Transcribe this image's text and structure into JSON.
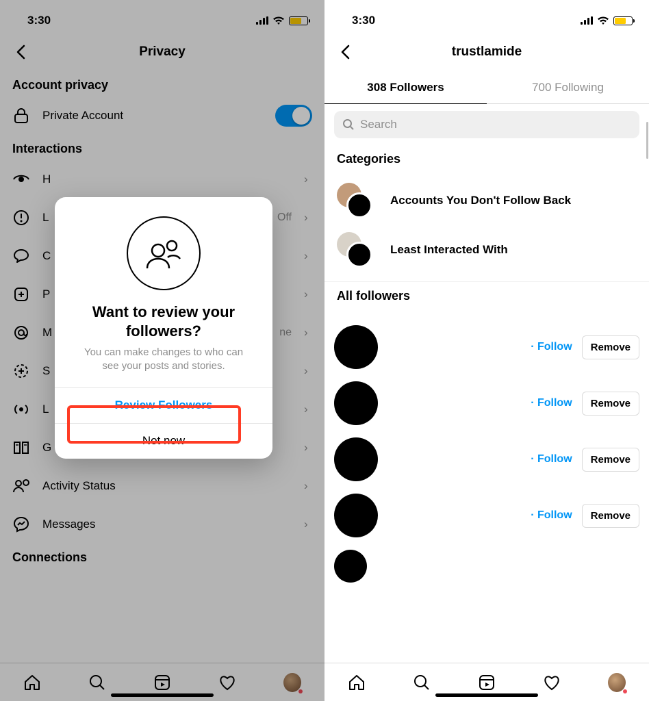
{
  "status": {
    "time": "3:30"
  },
  "left": {
    "title": "Privacy",
    "sections": {
      "account_privacy": "Account privacy",
      "interactions": "Interactions",
      "connections": "Connections"
    },
    "rows": {
      "private_account": "Private Account",
      "hidden_words": "H",
      "limits": "L",
      "limits_value": "Off",
      "comments": "C",
      "posts": "P",
      "mentions": "M",
      "mentions_value": "ne",
      "story": "S",
      "live": "L",
      "guides": "G",
      "activity_status": "Activity Status",
      "messages": "Messages"
    },
    "modal": {
      "title": "Want to review your followers?",
      "subtitle": "You can make changes to who can see your posts and stories.",
      "primary": "Review Followers",
      "secondary": "Not now"
    }
  },
  "right": {
    "username": "trustlamide",
    "tabs": {
      "followers": "308 Followers",
      "following": "700 Following"
    },
    "search_placeholder": "Search",
    "categories_title": "Categories",
    "categories": [
      {
        "label": "Accounts You Don't Follow Back"
      },
      {
        "label": "Least Interacted With"
      }
    ],
    "all_followers_title": "All followers",
    "follow_label": "Follow",
    "remove_label": "Remove"
  }
}
